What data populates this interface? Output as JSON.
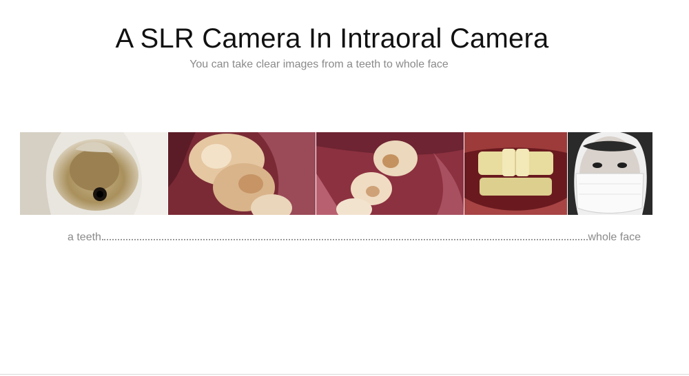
{
  "header": {
    "title": "A SLR Camera In Intraoral Camera",
    "subtitle": "You can take clear images from a teeth to whole face"
  },
  "gallery": {
    "photos": [
      {
        "name": "tooth-cavity-closeup-photo"
      },
      {
        "name": "molars-closeup-photo"
      },
      {
        "name": "lower-teeth-photo"
      },
      {
        "name": "smile-front-teeth-photo"
      },
      {
        "name": "masked-face-photo"
      }
    ]
  },
  "range": {
    "start_label": "a teeth",
    "end_label": "whole face"
  }
}
